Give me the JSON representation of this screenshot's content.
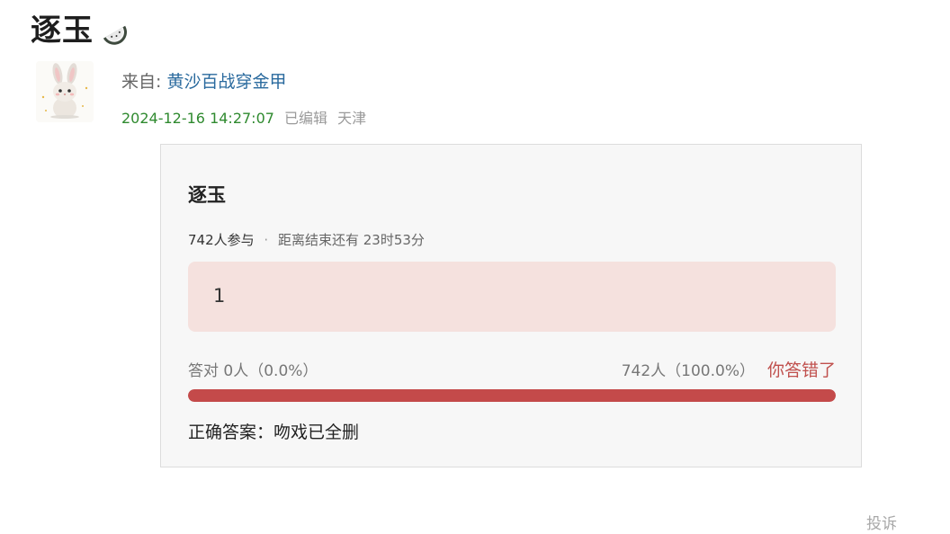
{
  "post": {
    "title": "逐玉",
    "title_icon": "watermelon-icon"
  },
  "author": {
    "avatar_icon": "rabbit-avatar",
    "from_prefix": "来自:",
    "name": "黄沙百战穿金甲",
    "date": "2024-12-16 14:27:07",
    "edited": "已编辑",
    "location": "天津"
  },
  "poll": {
    "title": "逐玉",
    "participants": "742人参与",
    "dot": "·",
    "remaining": "距离结束还有 23时53分",
    "option": "1",
    "correct_stat": "答对  0人（0.0%）",
    "chosen_stat": "742人（100.0%）",
    "wrong_label": "你答错了",
    "progress_fraction": 1.0,
    "answer": "正确答案：吻戏已全删"
  },
  "footer": {
    "report": "投诉"
  },
  "colors": {
    "author_name": "#2a6a9e",
    "date": "#2f8a2f",
    "option_bg": "#f5e1de",
    "progress": "#c44a4a",
    "wrong": "#c0504d"
  }
}
